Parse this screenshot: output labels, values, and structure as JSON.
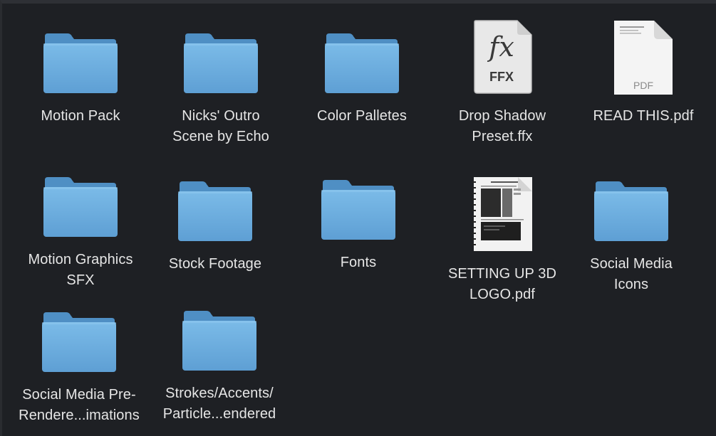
{
  "window": {
    "view": "icon-view"
  },
  "items": [
    {
      "label": "Motion Pack",
      "type": "folder"
    },
    {
      "label": "Nicks' Outro\nScene by Echo",
      "type": "folder"
    },
    {
      "label": "Color Palletes",
      "type": "folder"
    },
    {
      "label": "Drop Shadow\nPreset.ffx",
      "type": "ffx-file",
      "icon_glyph": "fx",
      "icon_caption": "FFX"
    },
    {
      "label": "READ THIS.pdf",
      "type": "pdf-file",
      "icon_caption": "PDF"
    },
    {
      "label": "Motion Graphics\nSFX",
      "type": "folder"
    },
    {
      "label": "Stock Footage",
      "type": "folder"
    },
    {
      "label": "Fonts",
      "type": "folder"
    },
    {
      "label": "SETTING UP 3D\nLOGO.pdf",
      "type": "pdf-file-preview"
    },
    {
      "label": "Social Media\nIcons",
      "type": "folder"
    },
    {
      "label": "Social Media Pre-\nRendere...imations",
      "type": "folder"
    },
    {
      "label": "Strokes/Accents/\nParticle...endered",
      "type": "folder"
    }
  ],
  "colors": {
    "background": "#1e2024",
    "folder_body": "#6aaee0",
    "folder_tab": "#4f8fc4",
    "label_text": "#e6e6e6"
  }
}
